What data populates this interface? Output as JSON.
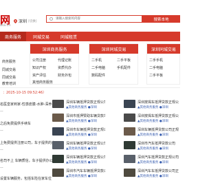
{
  "header": {
    "logo_text": "网",
    "logo_sub": "ata.cn",
    "city": "深圳",
    "city_switch": "[切换]",
    "search_placeholder": "请输入搜索的内容",
    "search_button": "搜索本地"
  },
  "nav": {
    "items": [
      {
        "label": "商务服务"
      },
      {
        "label": "同城交易"
      },
      {
        "label": "同城租赁"
      }
    ]
  },
  "sidebar": {
    "items": [
      "商务服务",
      "同城交易",
      "同城交易",
      "教育培训"
    ]
  },
  "categories": [
    {
      "title": "深圳商务服务",
      "links": [
        "公司注册",
        "代理记账",
        "知识产权",
        "资质代办",
        "资产评估",
        "财务外包",
        "其他商务服务"
      ]
    },
    {
      "title": "深圳同城交易",
      "links": [
        "二手机",
        "二手平板",
        "二手电脑",
        "手机配件",
        "数码配件"
      ]
    },
    {
      "title": "深圳同城交易",
      "links": [
        "二手手机",
        "二手电脑",
        "二手平板",
        "二手家电"
      ]
    }
  ],
  "date_line": "：2025-10-15 09:52:46）",
  "left_list": [
    "名医皇家到家-性感皮膜-水肿-深养-瘦身",
    "...",
    "之后免费提供手续车",
    "...",
    "上免费提供注册公司，车子提供的办公",
    "...",
    "名司不上 车辆质信，车子提供办公",
    "...",
    "设置车辆服务，包括车险在家车位"
  ],
  "feed_mid": [
    {
      "title": "深圳车辆抵押贷款正规公司 车辆抵押贷款不看",
      "sub": "▲其他商务服务 ●深圳"
    },
    {
      "title": "深圳市抵押赞助车辆贷款车车可以 公司有专门",
      "sub": "▲其他商务服务 ●深圳"
    },
    {
      "title": "深圳市车辆抵押贷款正规公司抵押车辆贷款",
      "sub": "▲其他商务服务 ●深圳"
    },
    {
      "title": "深圳车辆抵押贷款正规公司 车辆抵押贷款公司",
      "sub": "▲其他商务服务 ●深圳"
    },
    {
      "title": "深圳车辆抵押贷款正规公司 车辆抵押贷款不看",
      "sub": "▲其他商务服务 ●深圳"
    },
    {
      "title": "深圳市汽车车辆抵押贷款公司 全部不看 车辆",
      "sub": "▲其他商务服务 ●深圳"
    }
  ],
  "feed_right": [
    {
      "title": "深圳按揭车抵押贷款正规公司",
      "sub": "▲其他商务服务 ●深圳"
    },
    {
      "title": "深圳按揭车抵押贷款正规公司 车辆抵押贷款公司",
      "sub": "▲其他商务服务 ●深圳"
    },
    {
      "title": "深圳车辆抵押贷款公司正规车辆",
      "sub": "▲其他商务服务 ●深圳"
    },
    {
      "title": "深圳市汽车抵押贷款公司",
      "sub": "▲其他商务服务 ●深圳"
    },
    {
      "title": "深圳汽车抵押贷款正规公司抵押车辆",
      "sub": "▲其他商务服务 ●深圳"
    },
    {
      "title": "深圳汽车车抵押贷款公司正规",
      "sub": "▲其他商务服务 ●深圳"
    }
  ],
  "colors": {
    "brand": "#d63a2b",
    "link": "#3a5fb0"
  }
}
